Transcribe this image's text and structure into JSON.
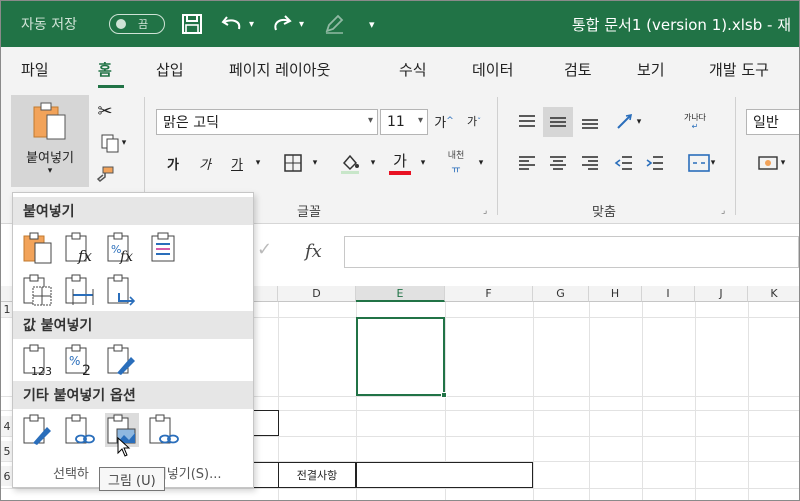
{
  "titlebar": {
    "autosave_label": "자동 저장",
    "toggle_state": "끔",
    "doc_title": "통합 문서1 (version 1).xlsb  -  재"
  },
  "tabs": [
    "파일",
    "홈",
    "삽입",
    "페이지 레이아웃",
    "수식",
    "데이터",
    "검토",
    "보기",
    "개발 도구"
  ],
  "ribbon": {
    "paste_label": "붙여넣기",
    "font_name": "맑은 고딕",
    "font_size": "11",
    "grow_font": "가",
    "shrink_font": "가",
    "bold": "가",
    "italic": "가",
    "underline": "가",
    "font_color_glyph": "가",
    "phonetic_label": "내천",
    "font_group_label": "글꼴",
    "align_group_label": "맞춤",
    "wrap_label": "가나다",
    "number_format": "일반"
  },
  "colors": {
    "accent": "#217346",
    "font_color": "#e81123"
  },
  "formula_bar": {
    "fx_label": "fx"
  },
  "columns": [
    {
      "label": "D",
      "selected": false
    },
    {
      "label": "E",
      "selected": true
    },
    {
      "label": "F",
      "selected": false
    },
    {
      "label": "G",
      "selected": false
    },
    {
      "label": "H",
      "selected": false
    },
    {
      "label": "I",
      "selected": false
    },
    {
      "label": "J",
      "selected": false
    },
    {
      "label": "K",
      "selected": false
    }
  ],
  "row_labels": [
    "1",
    "4",
    "5",
    "6"
  ],
  "cells": {
    "approval_cell": "전결사항"
  },
  "paste_menu": {
    "section_paste": "붙여넣기",
    "section_values": "값 붙여넣기",
    "section_other": "기타 붙여넣기 옵션",
    "paste_special": "선택하여 붙여넣기(S)...",
    "paste_special_hidden_part": "선택하",
    "paste_special_visible_part": "붙여넣기(S)...",
    "icons_paste": [
      "paste-icon",
      "paste-formulas-icon",
      "paste-formulas-number-formatting-icon",
      "keep-source-formatting-icon",
      "no-borders-icon",
      "keep-column-widths-icon",
      "transpose-icon"
    ],
    "icons_values": [
      "values-icon",
      "values-number-formatting-icon",
      "values-source-formatting-icon"
    ],
    "icons_other": [
      "formatting-icon",
      "paste-link-icon",
      "picture-icon",
      "linked-picture-icon"
    ]
  },
  "tooltip": "그림 (U)"
}
